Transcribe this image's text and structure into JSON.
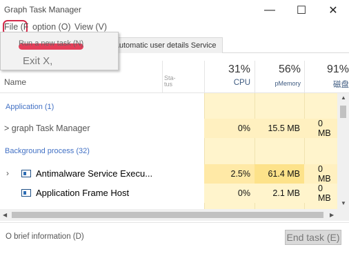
{
  "window": {
    "title": "Graph Task Manager",
    "minimize": "—",
    "maximize": "☐",
    "close": "✕"
  },
  "menu": {
    "file": "File (F",
    "option": "option (O)",
    "view": "View (V)"
  },
  "dropdown": {
    "run_new_task": "Run a new task (N)",
    "exit": "Exit X,"
  },
  "tabs": [
    {
      "label": ""
    },
    {
      "label": "Automatic user details Service"
    }
  ],
  "columns": {
    "name": "Name",
    "status_line1": "Sta-",
    "status_line2": "tus",
    "cpu": {
      "pct": "31%",
      "label": "CPU"
    },
    "memory": {
      "pct": "56%",
      "label": "pMemory"
    },
    "disk": {
      "pct": "91%",
      "label": "磁盘"
    }
  },
  "groups": {
    "apps": "Application (1)",
    "background": "Background process (32)"
  },
  "processes": [
    {
      "name": "> graph Task Manager",
      "cpu": "0%",
      "memory": "15.5 MB",
      "disk": "0 MB"
    },
    {
      "name": "Antimalware Service Execu...",
      "cpu": "2.5%",
      "memory": "61.4 MB",
      "disk": "0 MB"
    },
    {
      "name": "Application Frame Host",
      "cpu": "0%",
      "memory": "2.1 MB",
      "disk": "0 MB"
    }
  ],
  "footer": {
    "brief": "O brief information (D)",
    "end_task": "End task (E)"
  },
  "colors": {
    "heat_light": "#fff4cc",
    "heat_mid": "#ffe9a6",
    "heat_strong": "#fde28a",
    "accent": "#4170c4",
    "highlight": "#d22a4a"
  }
}
